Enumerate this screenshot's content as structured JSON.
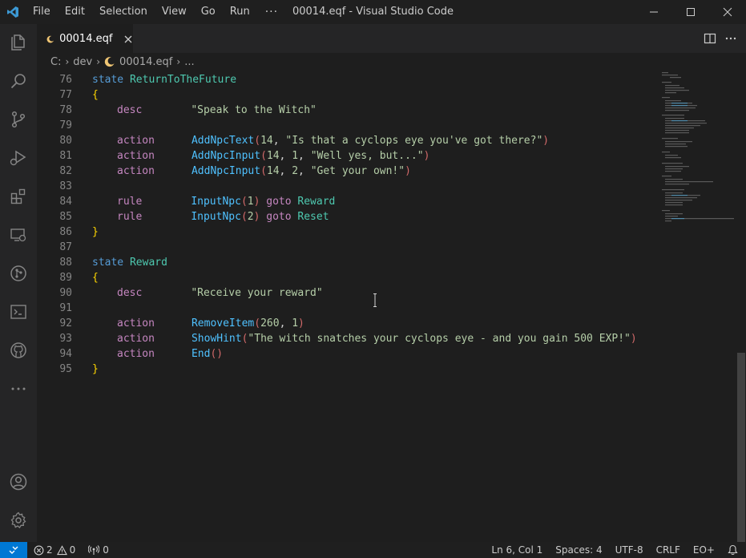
{
  "menu": {
    "items": [
      "File",
      "Edit",
      "Selection",
      "View",
      "Go",
      "Run"
    ],
    "more": "···"
  },
  "window": {
    "title": "00014.eqf - Visual Studio Code"
  },
  "tab": {
    "label": "00014.eqf"
  },
  "breadcrumb": {
    "drive": "C:",
    "folder": "dev",
    "file": "00014.eqf",
    "more": "..."
  },
  "editor": {
    "line_numbers": [
      "76",
      "77",
      "78",
      "79",
      "80",
      "81",
      "82",
      "83",
      "84",
      "85",
      "86",
      "87",
      "88",
      "89",
      "90",
      "91",
      "92",
      "93",
      "94",
      "95"
    ]
  },
  "code": {
    "l76": {
      "kw": "state",
      "name": "ReturnToTheFuture"
    },
    "l77": "{",
    "l78": {
      "kw": "desc",
      "str": "\"Speak to the Witch\""
    },
    "l80": {
      "kw": "action",
      "fn": "AddNpcText",
      "open": "(",
      "n1": "14",
      "sep": ", ",
      "str": "\"Is that a cyclops eye you've got there?\"",
      "close": ")"
    },
    "l81": {
      "kw": "action",
      "fn": "AddNpcInput",
      "open": "(",
      "n1": "14",
      "sep1": ", ",
      "n2": "1",
      "sep2": ", ",
      "str": "\"Well yes, but...\"",
      "close": ")"
    },
    "l82": {
      "kw": "action",
      "fn": "AddNpcInput",
      "open": "(",
      "n1": "14",
      "sep1": ", ",
      "n2": "2",
      "sep2": ", ",
      "str": "\"Get your own!\"",
      "close": ")"
    },
    "l84": {
      "kw": "rule",
      "fn": "InputNpc",
      "open": "(",
      "n": "1",
      "close": ")",
      "goto": "goto",
      "target": "Reward"
    },
    "l85": {
      "kw": "rule",
      "fn": "InputNpc",
      "open": "(",
      "n": "2",
      "close": ")",
      "goto": "goto",
      "target": "Reset"
    },
    "l86": "}",
    "l88": {
      "kw": "state",
      "name": "Reward"
    },
    "l89": "{",
    "l90": {
      "kw": "desc",
      "str": "\"Receive your reward\""
    },
    "l92": {
      "kw": "action",
      "fn": "RemoveItem",
      "open": "(",
      "n1": "260",
      "sep": ", ",
      "n2": "1",
      "close": ")"
    },
    "l93": {
      "kw": "action",
      "fn": "ShowHint",
      "open": "(",
      "str": "\"The witch snatches your cyclops eye - and you gain 500 EXP!\"",
      "close": ")"
    },
    "l94": {
      "kw": "action",
      "fn": "End",
      "open": "(",
      "close": ")"
    },
    "l95": "}"
  },
  "status": {
    "errors": "2",
    "warnings": "0",
    "ports": "0",
    "position": "Ln 6, Col 1",
    "spaces": "Spaces: 4",
    "encoding": "UTF-8",
    "eol": "CRLF",
    "language": "EO+"
  },
  "colors": {
    "accent": "#0078d4",
    "tab_icon": "#f0c674",
    "vscode_blue": "#3c99d4"
  }
}
